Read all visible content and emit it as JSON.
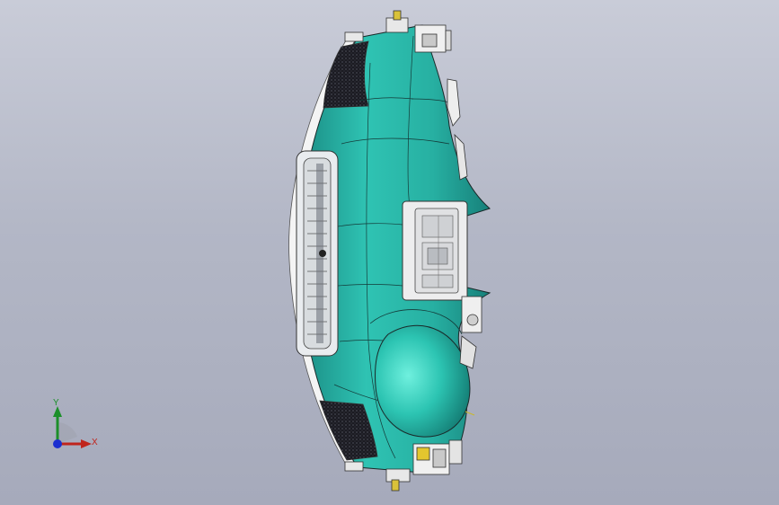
{
  "viewport": {
    "background_top": "#c9ccd8",
    "background_bottom": "#a6aabb"
  },
  "model": {
    "name_icon": "dashboard-panel-3d-model",
    "body_color": "#2fbfb0",
    "body_shadow_color": "#1f8f86",
    "trim_color": "#f2f2f2",
    "speaker_grille_color": "#1c1c22"
  },
  "triad": {
    "x_label": "X",
    "y_label": "Y",
    "x_color": "#c0241c",
    "y_color": "#1c8f2a",
    "z_color": "#1c2fd0"
  }
}
